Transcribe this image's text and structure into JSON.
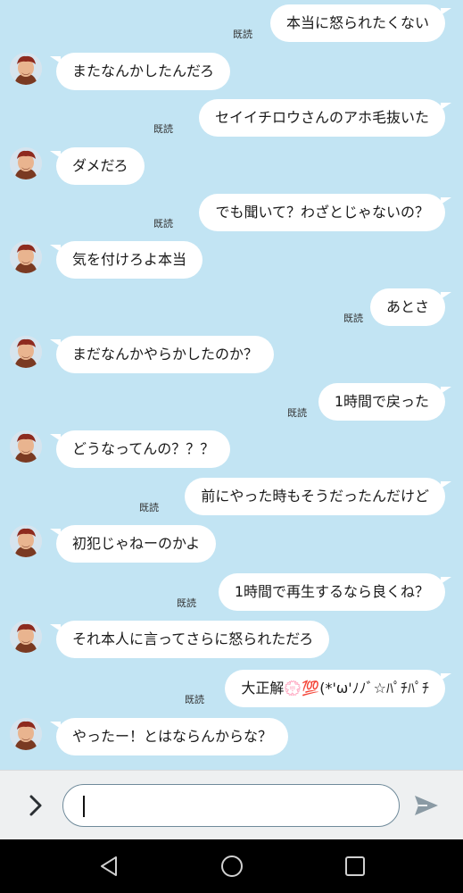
{
  "messages": [
    {
      "from": "me",
      "text": "本当に怒られたくない",
      "read": "既読"
    },
    {
      "from": "them",
      "text": "またなんかしたんだろ"
    },
    {
      "from": "me",
      "text": "セイイチロウさんのアホ毛抜いた",
      "read": "既読"
    },
    {
      "from": "them",
      "text": "ダメだろ"
    },
    {
      "from": "me",
      "text": "でも聞いて？わざとじゃないの？",
      "read": "既読"
    },
    {
      "from": "them",
      "text": "気を付けろよ本当"
    },
    {
      "from": "me",
      "text": "あとさ",
      "read": "既読"
    },
    {
      "from": "them",
      "text": "まだなんかやらかしたのか？"
    },
    {
      "from": "me",
      "text": "1時間で戻った",
      "read": "既読"
    },
    {
      "from": "them",
      "text": "どうなってんの？？？"
    },
    {
      "from": "me",
      "text": "前にやった時もそうだったんだけど",
      "read": "既読"
    },
    {
      "from": "them",
      "text": "初犯じゃねーのかよ"
    },
    {
      "from": "me",
      "text": "1時間で再生するなら良くね？",
      "read": "既読"
    },
    {
      "from": "them",
      "text": "それ本人に言ってさらに怒られただろ"
    },
    {
      "from": "me",
      "text": "大正解💮💯(*'ω'ﾉﾉﾞ☆ﾊﾟﾁﾊﾟﾁ",
      "read": "既読"
    },
    {
      "from": "them",
      "text": "やったー！とはならんからな？"
    }
  ],
  "input": {
    "value": "",
    "placeholder": ""
  },
  "colors": {
    "background": "#c2e4f3",
    "bubble": "#ffffff",
    "input_bar": "#eef0f1",
    "nav_bar": "#000000"
  },
  "icons": {
    "expand": "chevron-right-icon",
    "send": "send-icon",
    "back": "back-icon",
    "home": "home-icon",
    "recents": "recents-icon"
  }
}
